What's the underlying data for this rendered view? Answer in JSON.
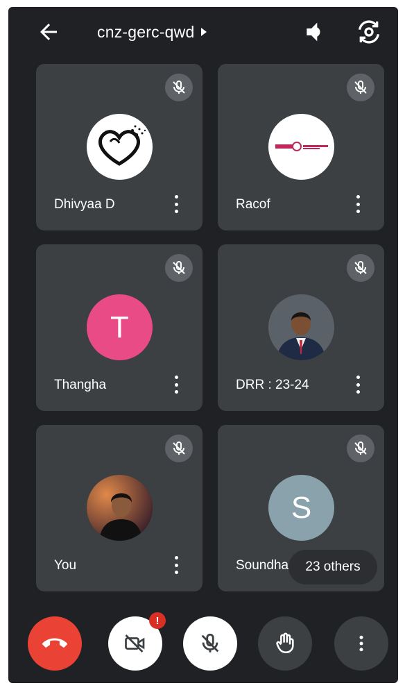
{
  "meeting": {
    "code": "cnz-gerc-qwd"
  },
  "participants": [
    {
      "name": "Dhivyaa D",
      "avatar": "heart-logo-image",
      "muted": true
    },
    {
      "name": "Racof",
      "avatar": "rotaract-logo-image",
      "muted": true
    },
    {
      "name": "Thangha",
      "avatar_letter": "T",
      "avatar_color": "#e84b86",
      "muted": true
    },
    {
      "name": "DRR : 23-24",
      "avatar": "man-in-suit-photo",
      "muted": true
    },
    {
      "name": "You",
      "avatar": "man-photo",
      "muted": true
    },
    {
      "name": "Soundhar",
      "avatar_letter": "S",
      "avatar_color": "#8aa2ac",
      "muted": true
    }
  ],
  "others_chip": {
    "label": "23 others"
  },
  "controls": {
    "end_call": "end-call",
    "camera": "camera-off",
    "camera_badge": "!",
    "mic": "mic-off",
    "raise_hand": "raise-hand",
    "more": "more-options"
  },
  "colors": {
    "background": "#202124",
    "tile": "#3c4043",
    "end_call": "#ea4335",
    "badge": "#d93025"
  }
}
